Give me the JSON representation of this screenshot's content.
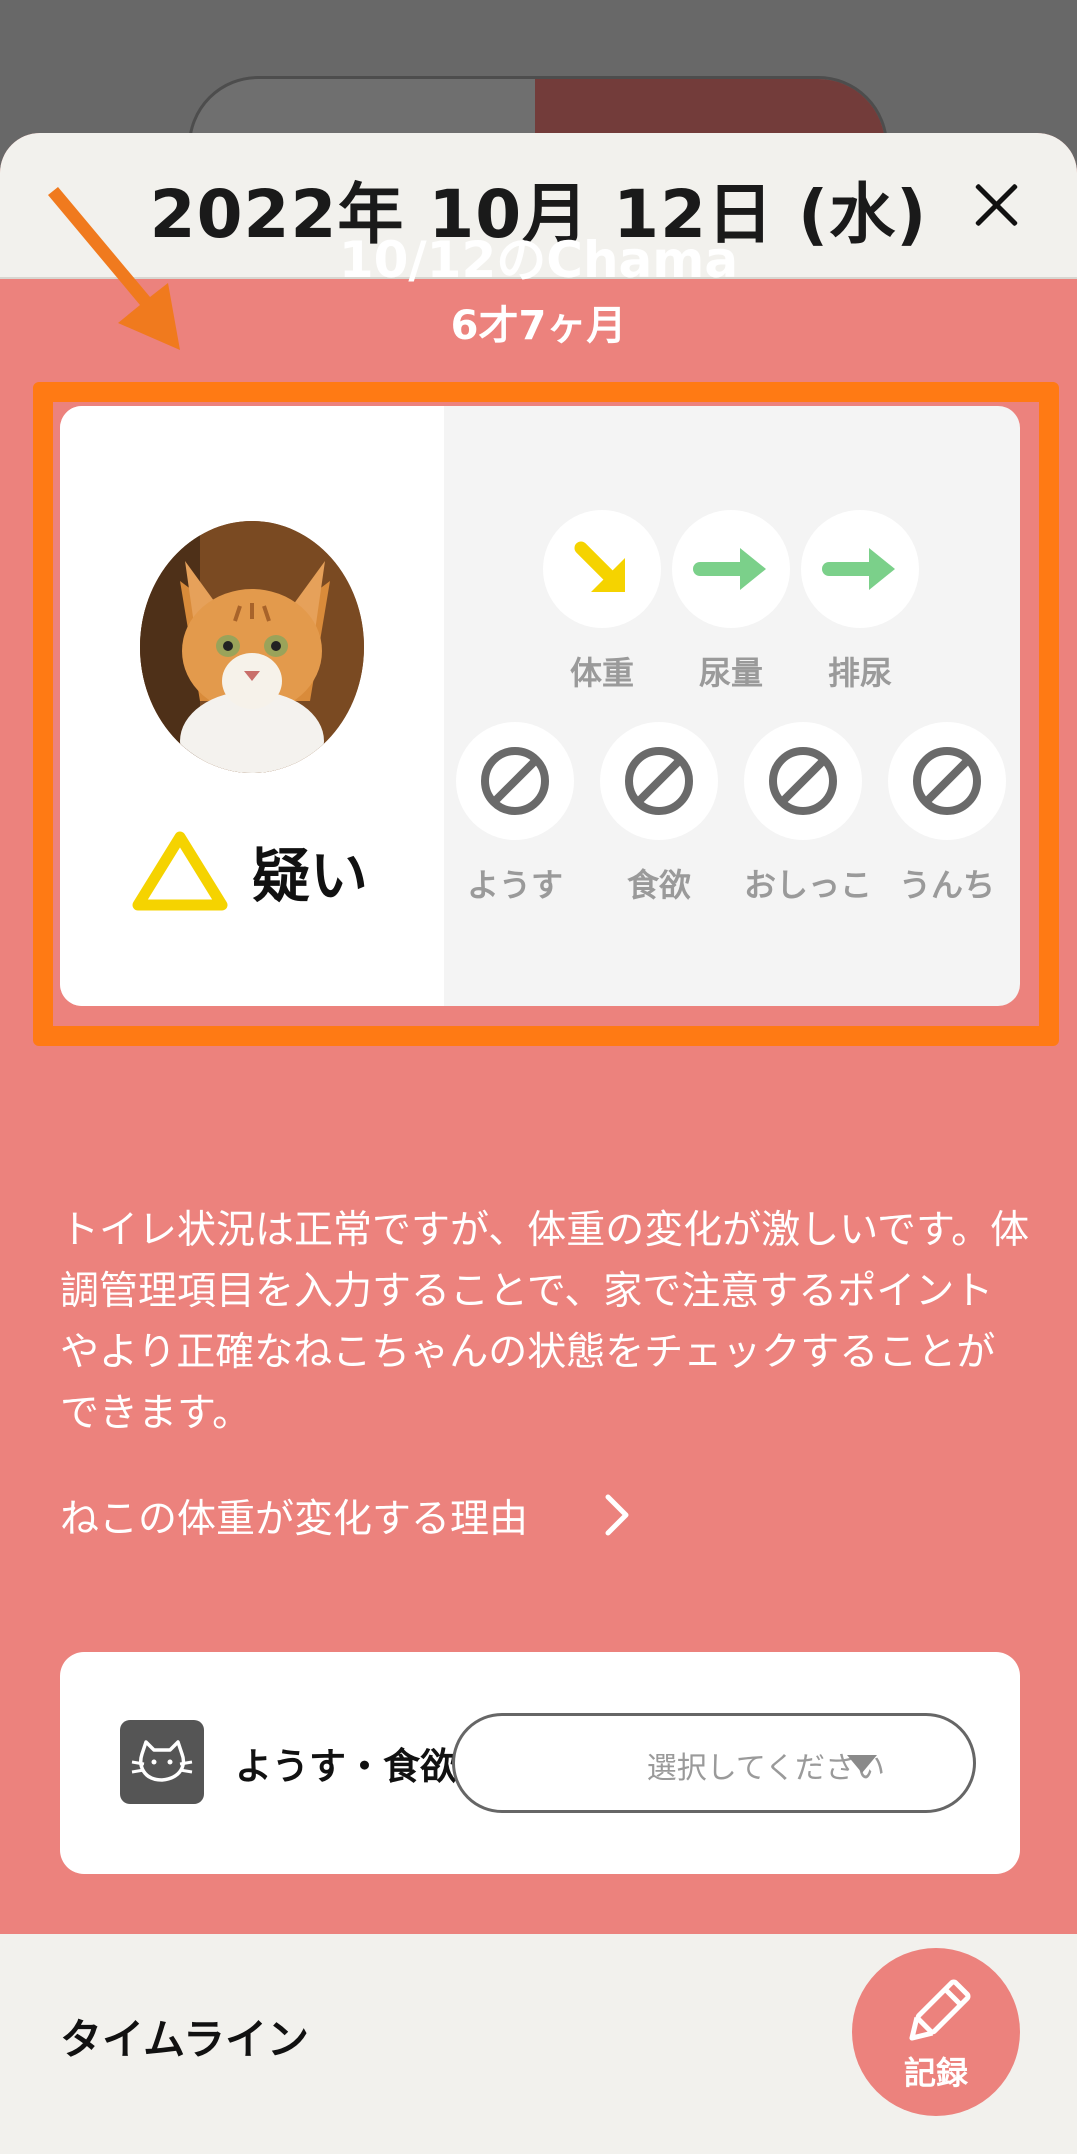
{
  "header": {
    "date_title": "2022年 10月 12日 (水)",
    "close_icon": "close-icon"
  },
  "pet": {
    "title": "10/12のChama",
    "age": "6才7ヶ月",
    "status_label": "疑い",
    "status_icon": "warning-triangle-icon",
    "status_color": "#f5d300"
  },
  "indicators_top": [
    {
      "label": "体重",
      "icon": "arrow-down-right-icon",
      "color": "#f5d300"
    },
    {
      "label": "尿量",
      "icon": "arrow-right-icon",
      "color": "#7bd08a"
    },
    {
      "label": "排尿",
      "icon": "arrow-right-icon",
      "color": "#7bd08a"
    }
  ],
  "indicators_bottom": [
    {
      "label": "ようす",
      "icon": "no-entry-icon"
    },
    {
      "label": "食欲",
      "icon": "no-entry-icon"
    },
    {
      "label": "おしっこ",
      "icon": "no-entry-icon"
    },
    {
      "label": "うんち",
      "icon": "no-entry-icon"
    }
  ],
  "description": "トイレ状況は正常ですが、体重の変化が激しいです。体調管理項目を入力することで、家で注意するポイントやより正確なねこちゃんの状態をチェックすることができます。",
  "reason_link": "ねこの体重が変化する理由",
  "input_row": {
    "label": "ようす・食欲",
    "select_placeholder": "選択してください"
  },
  "footer": {
    "timeline_label": "タイムライン",
    "record_label": "記録"
  },
  "colors": {
    "accent": "#ec827d",
    "highlight": "#ff7a14"
  }
}
